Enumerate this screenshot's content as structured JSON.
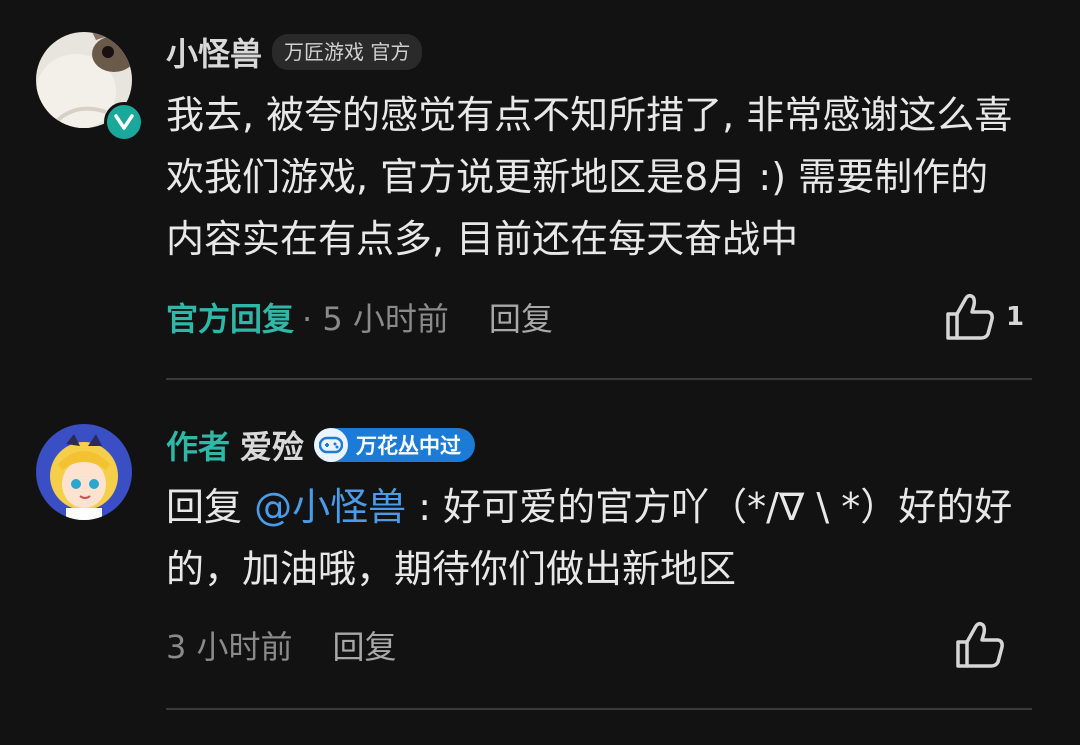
{
  "comments": [
    {
      "username": "小怪兽",
      "tag": "万匠游戏 官方",
      "text": "我去, 被夸的感觉有点不知所措了, 非常感谢这么喜欢我们游戏, 官方说更新地区是8月 :) 需要制作的内容实在有点多, 目前还在每天奋战中",
      "official_label": "官方回复",
      "time": "· 5 小时前",
      "reply_label": "回复",
      "likes": "1",
      "verified_color": "#1aa89a"
    },
    {
      "author_label": "作者",
      "username": "爱殓",
      "badge": "万花丛中过",
      "reply_prefix": "回复 ",
      "mention": "@小怪兽",
      "text": " : 好可爱的官方吖（*/∇ \\ *）好的好的，加油哦，期待你们做出新地区",
      "time": "3 小时前",
      "reply_label": "回复",
      "badge_color": "#1b7bd6"
    }
  ]
}
